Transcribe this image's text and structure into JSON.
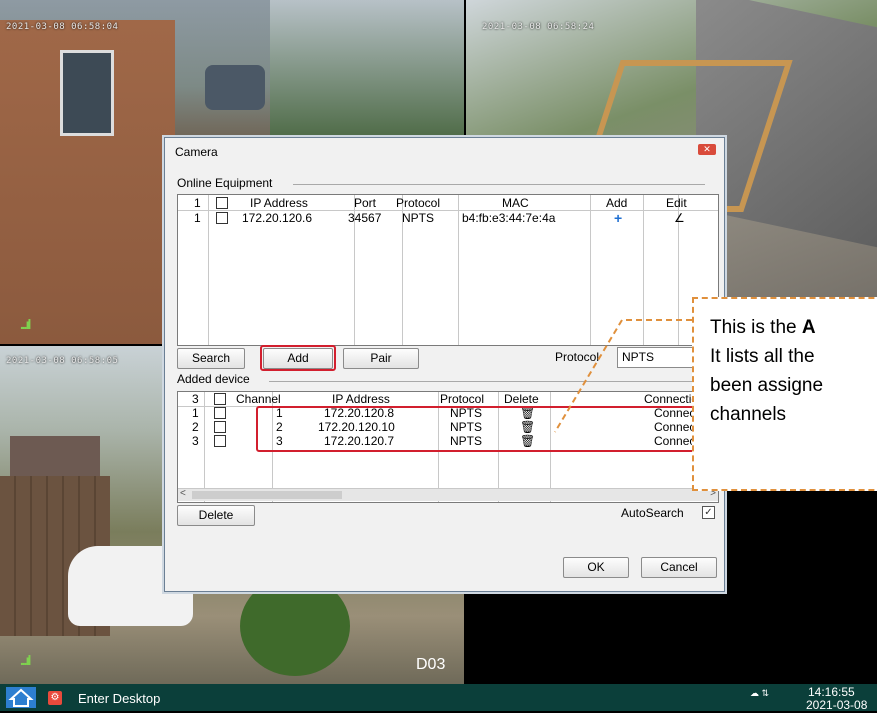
{
  "feeds": {
    "top_left_timestamp": "2021-03-08 06:58:04",
    "top_right_timestamp": "2021-03-08 06:58:24",
    "bottom_left_timestamp": "2021-03-08 06:58:05",
    "bottom_right_label": "D03",
    "signal": "...ıl"
  },
  "dialog": {
    "title": "Camera",
    "close": "✕",
    "online_group": "Online Equipment",
    "online_columns": {
      "count": "1",
      "ip": "IP Address",
      "port": "Port",
      "protocol": "Protocol",
      "mac": "MAC",
      "add": "Add",
      "edit": "Edit"
    },
    "online_rows": [
      {
        "index": "1",
        "ip": "172.20.120.6",
        "port": "34567",
        "protocol": "NPTS",
        "mac": "b4:fb:e3:44:7e:4a",
        "add": "+",
        "edit": "∠"
      }
    ],
    "buttons": {
      "search": "Search",
      "add": "Add",
      "pair": "Pair",
      "delete": "Delete",
      "ok": "OK",
      "cancel": "Cancel"
    },
    "protocol_label": "Protocol",
    "protocol_value": "NPTS",
    "added_group": "Added device",
    "added_columns": {
      "count": "3",
      "channel": "Channel",
      "ip": "IP Address",
      "protocol": "Protocol",
      "delete": "Delete",
      "connection": "Connection"
    },
    "added_rows": [
      {
        "index": "1",
        "channel": "1",
        "ip": "172.20.120.8",
        "protocol": "NPTS",
        "delete_icon": "trash-icon",
        "connection": "Connect"
      },
      {
        "index": "2",
        "channel": "2",
        "ip": "172.20.120.10",
        "protocol": "NPTS",
        "delete_icon": "trash-icon",
        "connection": "Connect"
      },
      {
        "index": "3",
        "channel": "3",
        "ip": "172.20.120.7",
        "protocol": "NPTS",
        "delete_icon": "trash-icon",
        "connection": "Connect"
      }
    ],
    "scroll_left": "<",
    "scroll_right": ">",
    "autosearch_label": "AutoSearch",
    "autosearch_checked": "✓"
  },
  "callout": {
    "line1_prefix": "This is the ",
    "line1_bold": "A",
    "line2": "It lists all the",
    "line3": "been assigne",
    "line4": "channels"
  },
  "taskbar": {
    "start_label": "Enter Desktop",
    "time": "14:16:55",
    "date": "2021-03-08"
  },
  "colors": {
    "highlight": "#d21f2e",
    "callout_border": "#e0903c",
    "taskbar": "#0b3f3a"
  }
}
